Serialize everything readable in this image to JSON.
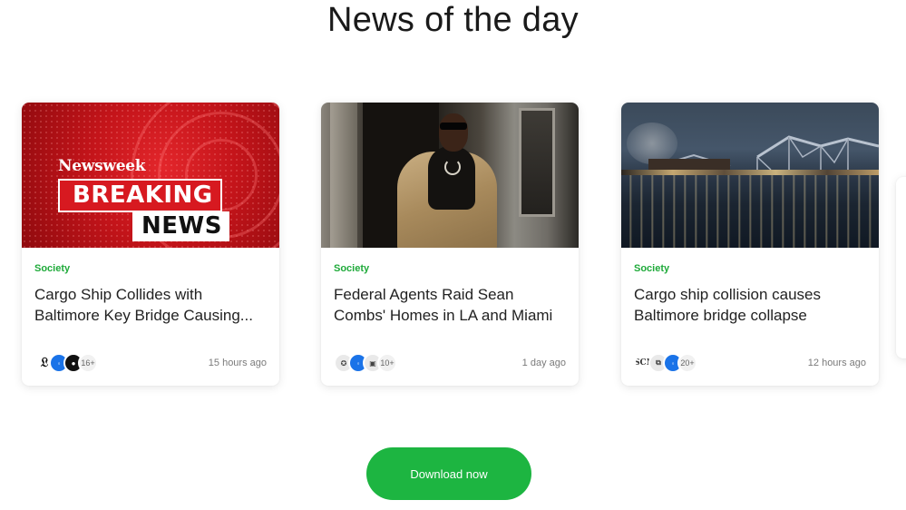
{
  "page": {
    "title": "News of the day"
  },
  "cards": [
    {
      "category": "Society",
      "headline": "Cargo Ship Collides with Baltimore Key Bridge Causing...",
      "time": "15 hours ago",
      "extra_sources": "16+",
      "thumb": {
        "brand": "Newsweek",
        "line1": "BREAKING",
        "line2": "NEWS"
      }
    },
    {
      "category": "Society",
      "headline": "Federal Agents Raid Sean Combs' Homes in LA and Miami",
      "time": "1 day ago",
      "extra_sources": "10+"
    },
    {
      "category": "Society",
      "headline": "Cargo ship collision causes Baltimore bridge collapse",
      "time": "12 hours ago",
      "extra_sources": "20+"
    }
  ],
  "cta": {
    "label": "Download now",
    "color": "#1db541"
  },
  "colors": {
    "category": "#1faa3a",
    "source_blue": "#1a73e8"
  }
}
